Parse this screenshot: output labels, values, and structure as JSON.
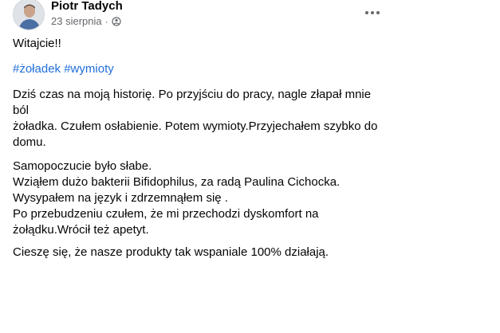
{
  "post": {
    "author": "Piotr Tadych",
    "date": "23 sierpnia",
    "separator": "·",
    "privacy_icon": "globe-icon",
    "more_icon": "more-options-icon",
    "greeting": "Witajcie!!",
    "hashtags": [
      "#żoładek",
      "#wymioty"
    ],
    "story_lines": [
      "Dziś czas na moją historię. Po przyjściu do pracy, nagle złapał mnie ból",
      "żoładka. Czułem osłabienie. Potem wymioty.Przyjechałem szybko do",
      "domu."
    ],
    "feel_lines": [
      "Samopoczucie było słabe.",
      "Wziąłem dużo bakterii Bifidophilus, za radą Paulina Cichocka.",
      "Wysypałem na język i zdrzemnąłem się .",
      "Po przebudzeniu czułem, że mi przechodzi dyskomfort na",
      "żołądku.Wrócił też apetyt."
    ],
    "closing": "Cieszę się, że nasze produkty tak wspaniale 100%  działają."
  },
  "colors": {
    "text": "#050505",
    "secondary": "#65676b",
    "hashtag": "#216fdb"
  }
}
